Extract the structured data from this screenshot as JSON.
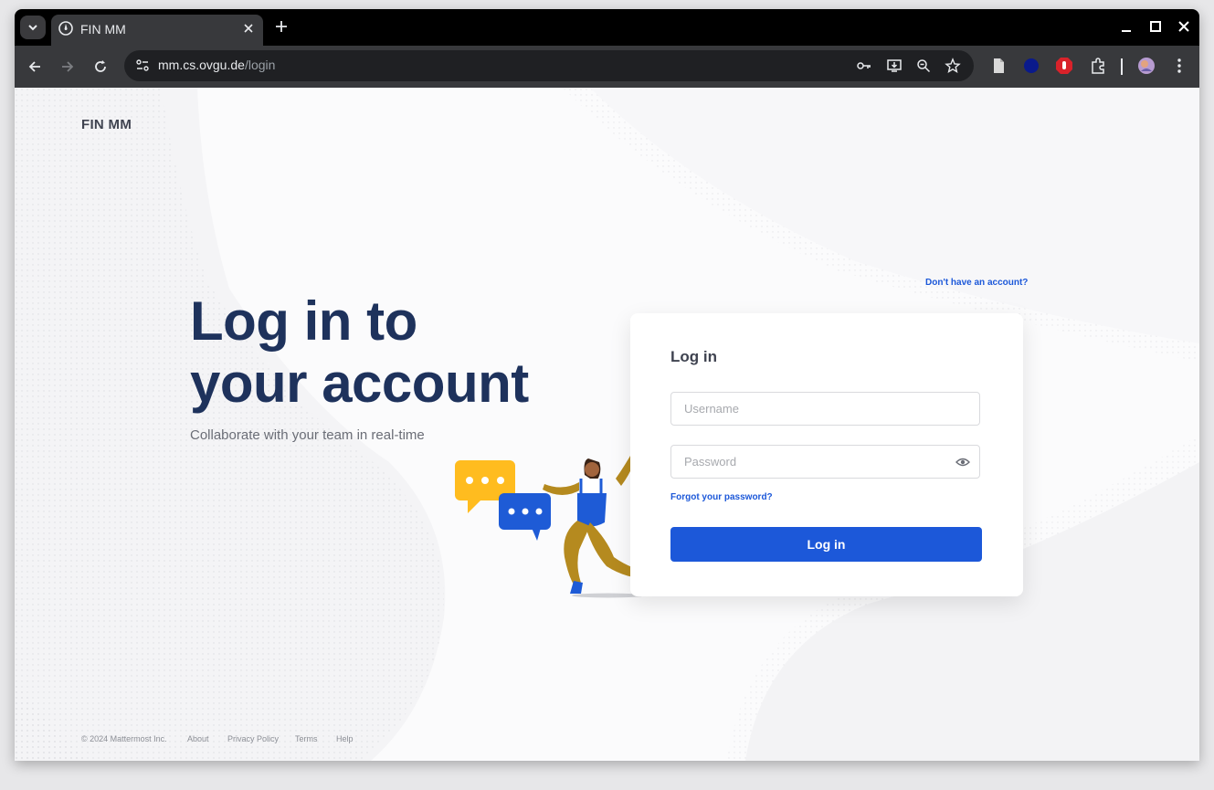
{
  "browser": {
    "tab_title": "FIN MM",
    "url_host": "mm.cs.ovgu.de",
    "url_path": "/login"
  },
  "page": {
    "brand": "FIN MM",
    "headline_line1": "Log in to",
    "headline_line2": "your account",
    "subheading": "Collaborate with your team in real-time",
    "signup_link": "Don't have an account?"
  },
  "login_form": {
    "title": "Log in",
    "username_placeholder": "Username",
    "password_placeholder": "Password",
    "forgot_password": "Forgot your password?",
    "submit_label": "Log in"
  },
  "footer": {
    "copyright": "© 2024 Mattermost Inc.",
    "links": [
      "About",
      "Privacy Policy",
      "Terms",
      "Help"
    ]
  },
  "colors": {
    "primary": "#1c58d9",
    "headline": "#1e325c",
    "chat_yellow": "#ffbc1f",
    "chat_blue": "#1e5bd6",
    "character_mustard": "#b58a1f"
  }
}
